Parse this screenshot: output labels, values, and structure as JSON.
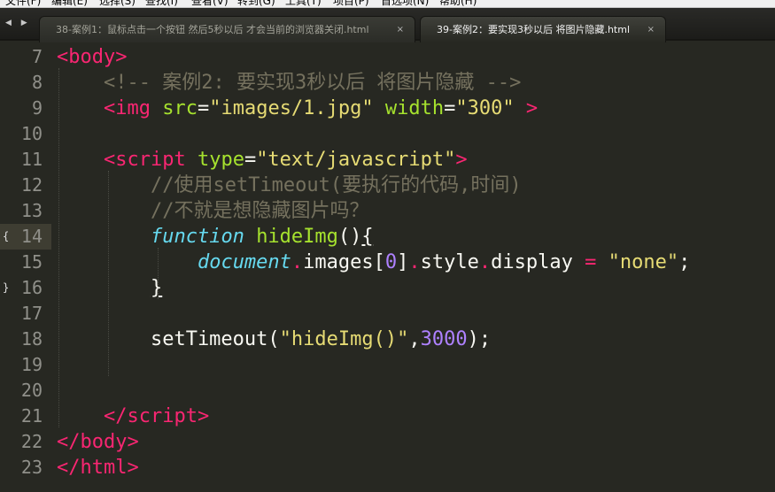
{
  "menu": {
    "items": [
      "文件(F)",
      "编辑(E)",
      "选择(S)",
      "查找(I)",
      "查看(V)",
      "转到(G)",
      "工具(T)",
      "项目(P)",
      "首选项(N)",
      "帮助(H)"
    ]
  },
  "tabs": [
    {
      "label": "38-案例1：鼠标点击一个按钮 然后5秒以后 才会当前的浏览器关闭.html",
      "close": "×",
      "active": false
    },
    {
      "label": "39-案例2：要实现3秒以后 将图片隐藏.html",
      "close": "×",
      "active": true
    }
  ],
  "nav": {
    "arrows": "◀ ▶"
  },
  "editor": {
    "current_line": "14",
    "fold_open": "{",
    "fold_close": "}",
    "lines": [
      {
        "num": "7",
        "tokens": [
          [
            "tg",
            "<body"
          ],
          [
            "tg",
            ">"
          ]
        ]
      },
      {
        "num": "8",
        "tokens": [
          [
            "pl",
            "    "
          ],
          [
            "cm",
            "<!-- 案例2: 要实现3秒以后 将图片隐藏 -->"
          ]
        ]
      },
      {
        "num": "9",
        "tokens": [
          [
            "pl",
            "    "
          ],
          [
            "tg",
            "<img"
          ],
          [
            "pl",
            " "
          ],
          [
            "at",
            "src"
          ],
          [
            "pl",
            "="
          ],
          [
            "st",
            "\"images/1.jpg\""
          ],
          [
            "pl",
            " "
          ],
          [
            "at",
            "width"
          ],
          [
            "pl",
            "="
          ],
          [
            "st",
            "\"300\""
          ],
          [
            "pl",
            " "
          ],
          [
            "tg",
            ">"
          ]
        ]
      },
      {
        "num": "10",
        "tokens": []
      },
      {
        "num": "11",
        "tokens": [
          [
            "pl",
            "    "
          ],
          [
            "tg",
            "<script"
          ],
          [
            "pl",
            " "
          ],
          [
            "at",
            "type"
          ],
          [
            "pl",
            "="
          ],
          [
            "st",
            "\"text/javascript\""
          ],
          [
            "tg",
            ">"
          ]
        ]
      },
      {
        "num": "12",
        "tokens": [
          [
            "pl",
            "        "
          ],
          [
            "cm",
            "//使用setTimeout(要执行的代码,时间)"
          ]
        ]
      },
      {
        "num": "13",
        "tokens": [
          [
            "pl",
            "        "
          ],
          [
            "cm",
            "//不就是想隐藏图片吗？"
          ]
        ]
      },
      {
        "num": "14",
        "tokens": [
          [
            "pl",
            "        "
          ],
          [
            "kw",
            "function"
          ],
          [
            "pl",
            " "
          ],
          [
            "fn",
            "hideImg"
          ],
          [
            "pl",
            "()"
          ],
          [
            "ul",
            "{"
          ]
        ]
      },
      {
        "num": "15",
        "tokens": [
          [
            "pl",
            "            "
          ],
          [
            "kw",
            "document"
          ],
          [
            "op",
            "."
          ],
          [
            "pl",
            "images["
          ],
          [
            "num",
            "0"
          ],
          [
            "pl",
            "]"
          ],
          [
            "op",
            "."
          ],
          [
            "pl",
            "style"
          ],
          [
            "op",
            "."
          ],
          [
            "pl",
            "display "
          ],
          [
            "op",
            "="
          ],
          [
            "pl",
            " "
          ],
          [
            "st",
            "\"none\""
          ],
          [
            "pl",
            ";"
          ]
        ]
      },
      {
        "num": "16",
        "tokens": [
          [
            "pl",
            "        "
          ],
          [
            "ul",
            "}"
          ]
        ]
      },
      {
        "num": "17",
        "tokens": []
      },
      {
        "num": "18",
        "tokens": [
          [
            "pl",
            "        setTimeout("
          ],
          [
            "st",
            "\"hideImg()\""
          ],
          [
            "pl",
            ","
          ],
          [
            "num",
            "3000"
          ],
          [
            "pl",
            ");"
          ]
        ]
      },
      {
        "num": "19",
        "tokens": []
      },
      {
        "num": "20",
        "tokens": []
      },
      {
        "num": "21",
        "tokens": [
          [
            "pl",
            "    "
          ],
          [
            "tg",
            "</"
          ],
          [
            "tg",
            "script"
          ],
          [
            "tg",
            ">"
          ]
        ]
      },
      {
        "num": "22",
        "tokens": [
          [
            "tg",
            "</"
          ],
          [
            "tg",
            "body"
          ],
          [
            "tg",
            ">"
          ]
        ]
      },
      {
        "num": "23",
        "tokens": [
          [
            "tg",
            "</"
          ],
          [
            "tg",
            "html"
          ],
          [
            "tg",
            ">"
          ]
        ]
      }
    ]
  },
  "colors": {
    "background": "#272822",
    "tag": "#f92672",
    "attribute": "#a6e22e",
    "string": "#e6db74",
    "comment": "#75715e",
    "keyword": "#66d9ef",
    "number": "#ae81ff"
  }
}
